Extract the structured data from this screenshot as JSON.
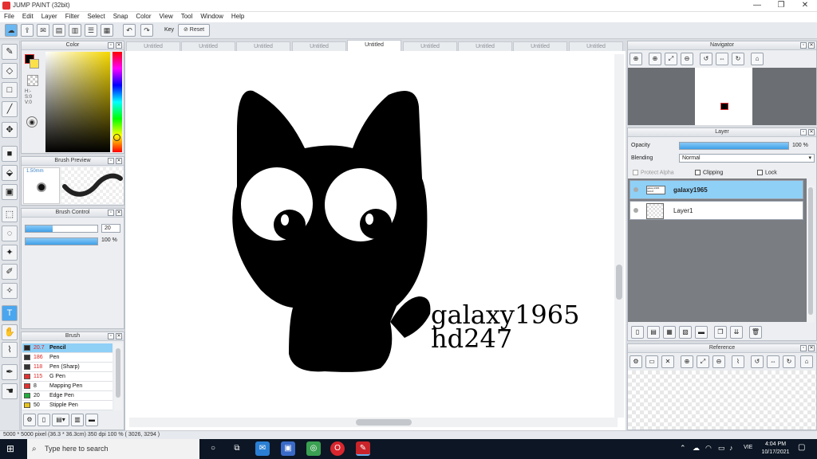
{
  "window": {
    "title": "JUMP PAINT (32bit)",
    "minimize": "—",
    "restore": "❐",
    "close": "✕"
  },
  "menu": [
    "File",
    "Edit",
    "Layer",
    "Filter",
    "Select",
    "Snap",
    "Color",
    "View",
    "Tool",
    "Window",
    "Help"
  ],
  "toolbar": {
    "key_label": "Key",
    "reset_label": "Reset"
  },
  "tabs": [
    "Untitled",
    "Untitled",
    "Untitled",
    "Untitled",
    "Untitled",
    "Untitled",
    "Untitled",
    "Untitled",
    "Untitled"
  ],
  "active_tab_index": 4,
  "color_panel": {
    "title": "Color",
    "hsv": [
      "H:-",
      "S:0",
      "V:0"
    ]
  },
  "brush_preview": {
    "title": "Brush Preview",
    "size": "1.50mm"
  },
  "brush_control": {
    "title": "Brush Control",
    "size_value": "20",
    "opacity_value": "100 %",
    "size_fraction": 0.38,
    "opacity_fraction": 1.0
  },
  "brush": {
    "title": "Brush",
    "items": [
      {
        "size": "20.7",
        "name": "Pencil",
        "color": "#222222",
        "selected": true
      },
      {
        "size": "186",
        "name": "Pen",
        "color": "#333333"
      },
      {
        "size": "118",
        "name": "Pen (Sharp)",
        "color": "#333333"
      },
      {
        "size": "115",
        "name": "G Pen",
        "color": "#e43030"
      },
      {
        "size": "8",
        "name": "Mapping Pen",
        "color": "#e43030"
      },
      {
        "size": "20",
        "name": "Edge Pen",
        "color": "#1fae3a"
      },
      {
        "size": "50",
        "name": "Stipple Pen",
        "color": "#e6c31a"
      }
    ]
  },
  "canvas_text": {
    "line1": "galaxy1965",
    "line2": "hd247"
  },
  "navigator": {
    "title": "Navigator"
  },
  "layer_panel": {
    "title": "Layer",
    "opacity_label": "Opacity",
    "opacity_value": "100 %",
    "opacity_fraction": 1.0,
    "blending_label": "Blending",
    "blending_value": "Normal",
    "protect_alpha": "Protect Alpha",
    "clipping": "Clipping",
    "lock": "Lock",
    "layers": [
      {
        "name": "galaxy1965",
        "selected": true,
        "thumb_text": "galaxy1965 hd247"
      },
      {
        "name": "Layer1",
        "selected": false
      }
    ]
  },
  "reference": {
    "title": "Reference"
  },
  "status": {
    "text": "5000 * 5000 pixel  (36.3 * 36.3cm)  350 dpi  100 %  ( 3026, 3294 )"
  },
  "taskbar": {
    "search_placeholder": "Type here to search",
    "lang": "VIE",
    "time": "4:04 PM",
    "date": "10/17/2021"
  }
}
